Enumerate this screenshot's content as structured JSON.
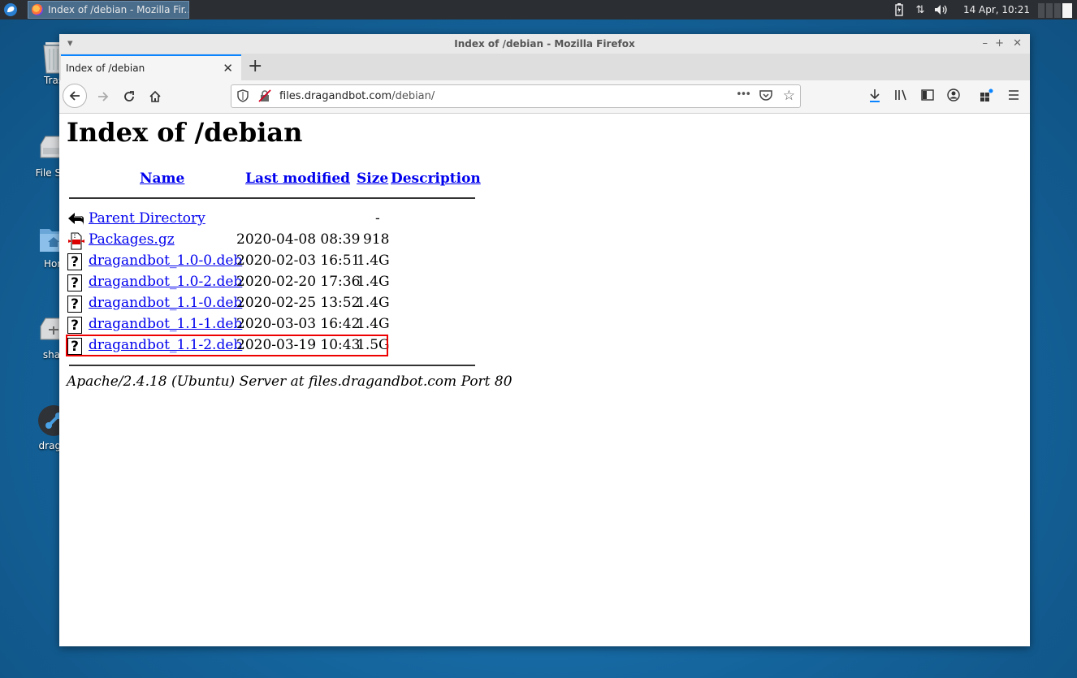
{
  "panel": {
    "task_title": "Index of /debian - Mozilla Fir...",
    "clock": "14 Apr, 10:21"
  },
  "desktop": {
    "icons": [
      {
        "label": "Tras"
      },
      {
        "label": "File Sys"
      },
      {
        "label": "Hon"
      },
      {
        "label": "shar"
      },
      {
        "label": "drag&"
      }
    ]
  },
  "window": {
    "title": "Index of /debian - Mozilla Firefox",
    "tab_label": "Index of /debian",
    "url_host": "files.dragandbot.com",
    "url_path": "/debian/",
    "url_more": "•••"
  },
  "page": {
    "heading": "Index of /debian",
    "columns": {
      "name": "Name",
      "modified": "Last modified",
      "size": "Size",
      "description": "Description"
    },
    "rows": [
      {
        "name": "Parent Directory",
        "modified": "",
        "size": "-",
        "icon": "back-icon"
      },
      {
        "name": "Packages.gz",
        "modified": "2020-04-08 08:39",
        "size": "918",
        "icon": "compressed-icon"
      },
      {
        "name": "dragandbot_1.0-0.deb",
        "modified": "2020-02-03 16:51",
        "size": "1.4G",
        "icon": "unknown-file-icon"
      },
      {
        "name": "dragandbot_1.0-2.deb",
        "modified": "2020-02-20 17:36",
        "size": "1.4G",
        "icon": "unknown-file-icon"
      },
      {
        "name": "dragandbot_1.1-0.deb",
        "modified": "2020-02-25 13:52",
        "size": "1.4G",
        "icon": "unknown-file-icon"
      },
      {
        "name": "dragandbot_1.1-1.deb",
        "modified": "2020-03-03 16:42",
        "size": "1.4G",
        "icon": "unknown-file-icon"
      },
      {
        "name": "dragandbot_1.1-2.deb",
        "modified": "2020-03-19 10:43",
        "size": "1.5G",
        "icon": "unknown-file-icon"
      }
    ],
    "address": "Apache/2.4.18 (Ubuntu) Server at files.dragandbot.com Port 80"
  },
  "colors": {
    "link": "#0000ee",
    "highlight": "#e00000",
    "accent": "#0a84ff"
  }
}
